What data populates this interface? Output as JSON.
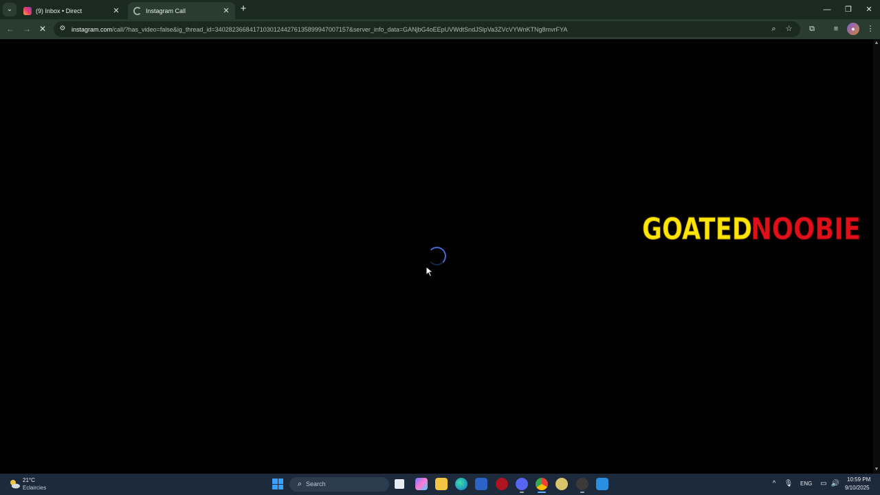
{
  "browser": {
    "tabs": [
      {
        "title": "(9) Inbox • Direct",
        "favicon": "instagram-icon",
        "active": false
      },
      {
        "title": "Instagram Call",
        "favicon": "loading-icon",
        "active": true
      }
    ],
    "url_host": "instagram.com",
    "url_rest": "/call/?has_video=false&ig_thread_id=340282366841710301244276135899947007157&server_info_data=GANjbG4oEEpUVWdtSndJSlpVa3ZVcVYWnKTNg8mvrFYA",
    "tab_close_glyph": "✕",
    "new_tab_glyph": "+",
    "accent": "#2a3c2f"
  },
  "page": {
    "watermark": {
      "part1": "GOATED",
      "part2": "NOOBIE",
      "color1": "#ffe600",
      "color2": "#e0101a"
    },
    "spinner_color": "#3f6fd6"
  },
  "taskbar": {
    "weather_temp": "21°C",
    "weather_desc": "Eclaircies",
    "search_placeholder": "Search",
    "language": "ENG",
    "time": "10:59 PM",
    "date": "9/10/2025"
  }
}
